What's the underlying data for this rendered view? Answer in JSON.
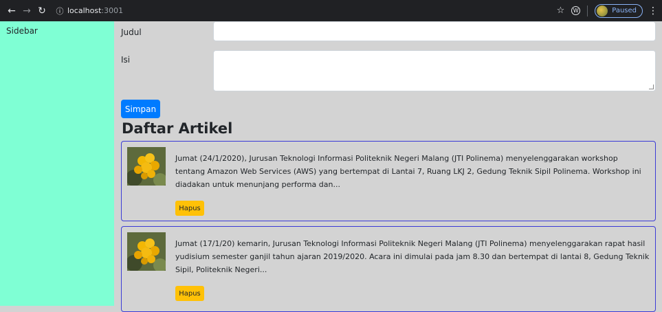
{
  "browser": {
    "url_host": "localhost",
    "url_port": ":3001",
    "profile_status": "Paused"
  },
  "sidebar": {
    "label": "Sidebar"
  },
  "form": {
    "title_label": "Judul",
    "title_value": "",
    "body_label": "Isi",
    "body_value": "",
    "submit_label": "Simpan"
  },
  "articles": {
    "heading": "Daftar Artikel",
    "items": [
      {
        "text": "Jumat (24/1/2020), Jurusan Teknologi Informasi Politeknik Negeri Malang (JTI Polinema) menyelenggarakan workshop tentang Amazon Web Services (AWS) yang bertempat di Lantai 7, Ruang LKJ 2, Gedung Teknik Sipil Polinema. Workshop ini diadakan untuk menunjang performa dan...",
        "delete_label": "Hapus"
      },
      {
        "text": "Jumat (17/1/20) kemarin, Jurusan Teknologi Informasi Politeknik Negeri Malang (JTI Polinema) menyelenggarakan rapat hasil yudisium semester ganjil tahun ajaran 2019/2020. Acara ini dimulai pada jam 8.30 dan bertempat di lantai 8, Gedung Teknik Sipil, Politeknik Negeri...",
        "delete_label": "Hapus"
      }
    ]
  }
}
